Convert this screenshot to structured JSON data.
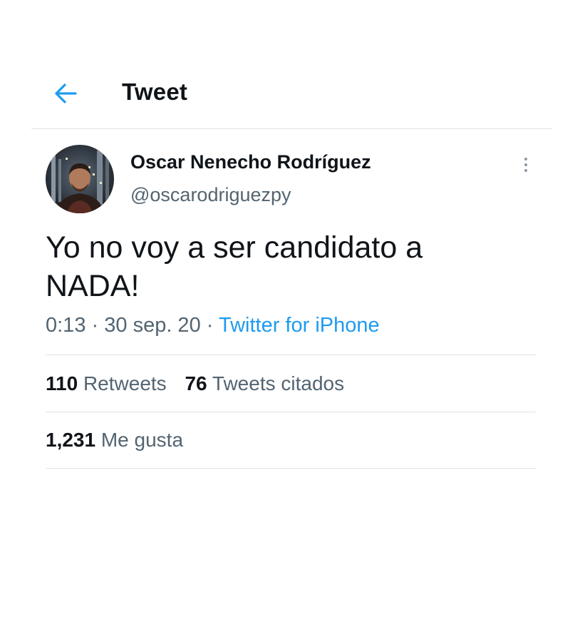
{
  "header": {
    "title": "Tweet",
    "back_icon": "arrow-left-icon",
    "accent_color": "#1d9bf0"
  },
  "author": {
    "name": "Oscar Nenecho Rodríguez",
    "handle": "@oscarodriguezpy",
    "avatar_icon": "avatar-photo"
  },
  "tweet": {
    "text_line1": "Yo no voy a ser candidato a",
    "text_line2": "NADA!",
    "time": "0:13",
    "date": "30 sep. 20",
    "separator": "·",
    "source": "Twitter for iPhone"
  },
  "stats": {
    "retweets_count": "110",
    "retweets_label": "Retweets",
    "quotes_count": "76",
    "quotes_label": "Tweets citados",
    "likes_count": "1,231",
    "likes_label": "Me gusta"
  },
  "more_icon": "more-vertical-icon"
}
